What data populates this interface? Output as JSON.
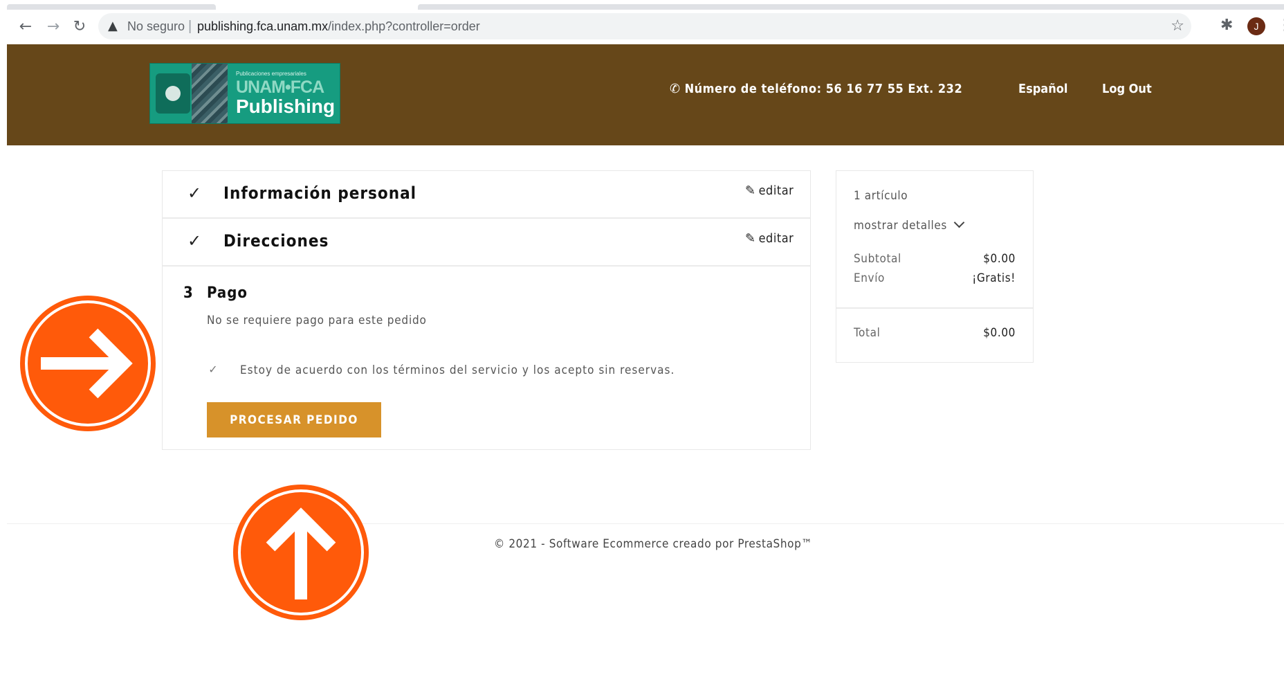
{
  "browser": {
    "security_label": "No seguro",
    "url_host": "publishing.fca.unam.mx",
    "url_path": "/index.php?controller=order",
    "avatar_letter": "J"
  },
  "header": {
    "logo": {
      "tagline": "Publicaciones empresariales",
      "line1": "UNAM•FCA",
      "line2": "Publishing"
    },
    "phone": "Número de teléfono: 56 16 77 55 Ext. 232",
    "language": "Español",
    "logout": "Log Out",
    "bg_color": "#664719"
  },
  "checkout": {
    "steps": [
      {
        "title": "Información personal",
        "edit_label": "editar",
        "completed": true
      },
      {
        "title": "Direcciones",
        "edit_label": "editar",
        "completed": true
      }
    ],
    "payment": {
      "number": "3",
      "title": "Pago",
      "description": "No se requiere pago para este pedido",
      "terms_label": "Estoy de acuerdo con los términos del servicio y los acepto sin reservas.",
      "terms_checked": true,
      "submit_label": "PROCESAR PEDIDO",
      "button_color": "#d7922a"
    }
  },
  "summary": {
    "items_count": "1 artículo",
    "details_toggle": "mostrar detalles",
    "subtotal_label": "Subtotal",
    "subtotal_value": "$0.00",
    "shipping_label": "Envío",
    "shipping_value": "¡Gratis!",
    "total_label": "Total",
    "total_value": "$0.00"
  },
  "footer": {
    "text": "© 2021 - Software Ecommerce creado por PrestaShop™"
  },
  "annotations": {
    "color": "#ff5a0a",
    "arrows": [
      "arrow-right-icon",
      "arrow-up-icon"
    ]
  }
}
